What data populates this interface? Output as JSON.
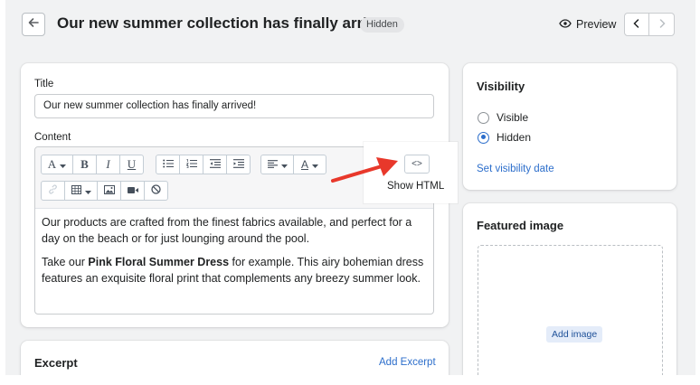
{
  "header": {
    "title": "Our new summer collection has finally arrived!",
    "status_badge": "Hidden",
    "preview_label": "Preview"
  },
  "main_card": {
    "title_label": "Title",
    "title_value": "Our new summer collection has finally arrived!",
    "content_label": "Content",
    "toolbar": {
      "font_glyph": "A",
      "bold_glyph": "B",
      "italic_glyph": "I",
      "underline_glyph": "U",
      "text_color_glyph": "A",
      "html_glyph": "<>"
    },
    "tooltip": "Show HTML",
    "paragraph_1": "Our products are crafted from the finest fabrics available, and perfect for a day on the beach or for just lounging around the pool.",
    "paragraph_2_before": "Take our ",
    "paragraph_2_bold": "Pink Floral Summer Dress",
    "paragraph_2_after": " for example. This airy bohemian dress features an exquisite floral print that complements any breezy summer look."
  },
  "excerpt_card": {
    "title": "Excerpt",
    "action": "Add Excerpt"
  },
  "visibility_card": {
    "title": "Visibility",
    "options": [
      {
        "label": "Visible",
        "selected": false
      },
      {
        "label": "Hidden",
        "selected": true
      }
    ],
    "set_date_link": "Set visibility date"
  },
  "featured_image_card": {
    "title": "Featured image",
    "add_image_button": "Add image"
  },
  "colors": {
    "accent": "#2c6ecb",
    "annotation_arrow": "#e8382b"
  }
}
